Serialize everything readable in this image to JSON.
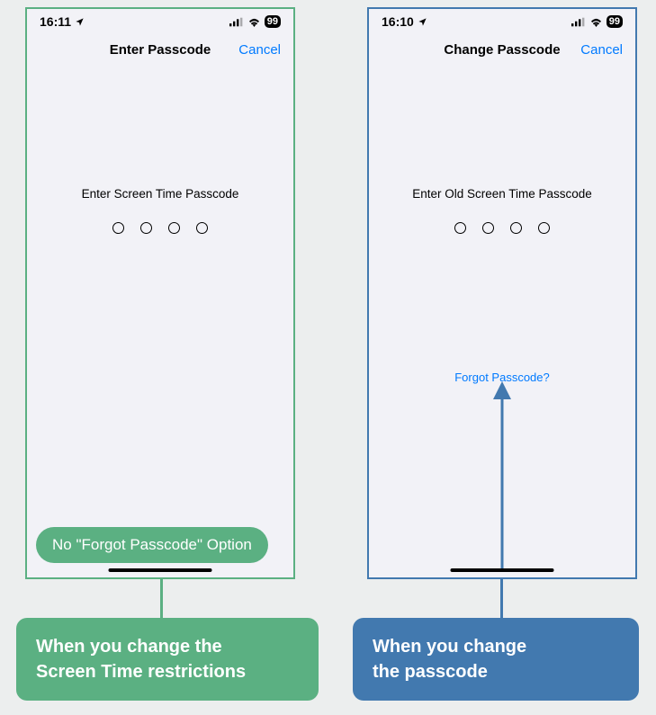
{
  "left": {
    "status_time": "16:11",
    "battery": "99",
    "nav_title": "Enter Passcode",
    "nav_cancel": "Cancel",
    "prompt": "Enter Screen Time Passcode"
  },
  "right": {
    "status_time": "16:10",
    "battery": "99",
    "nav_title": "Change Passcode",
    "nav_cancel": "Cancel",
    "prompt": "Enter Old Screen Time Passcode",
    "forgot": "Forgot Passcode?"
  },
  "pill_label": "No \"Forgot Passcode\" Option",
  "caption_left_line1": "When you change the",
  "caption_left_line2": "Screen Time restrictions",
  "caption_right_line1": "When you change",
  "caption_right_line2": "the passcode",
  "colors": {
    "green": "#5bb082",
    "blue": "#4279af",
    "ios_blue": "#007aff"
  }
}
